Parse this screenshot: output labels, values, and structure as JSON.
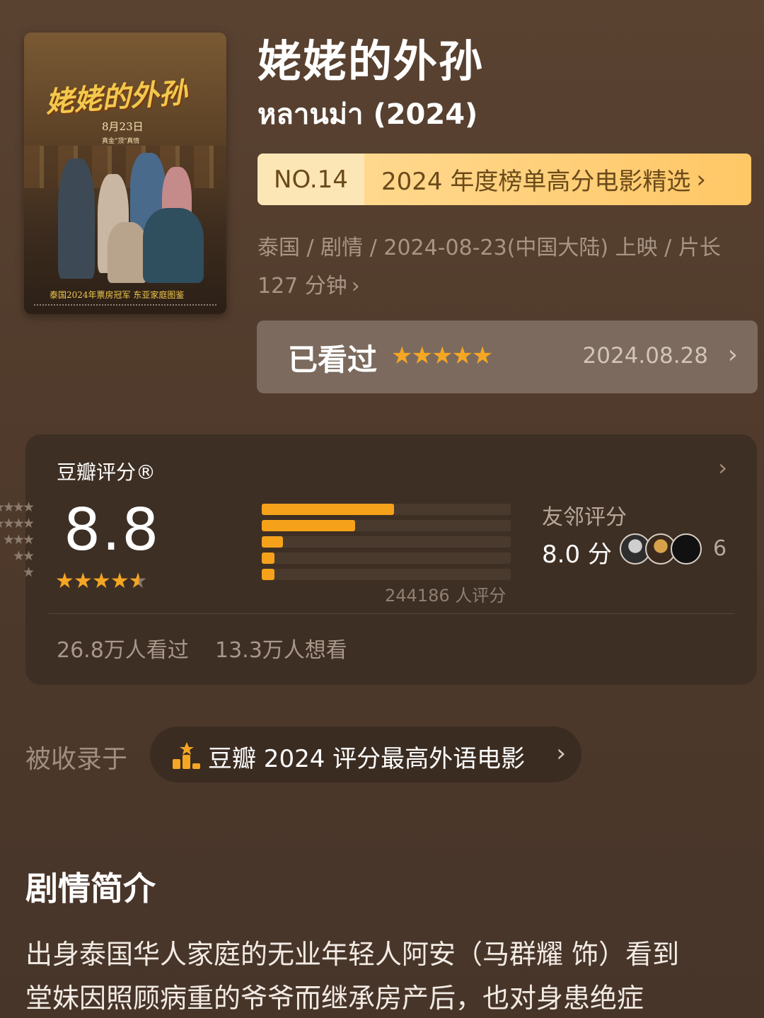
{
  "poster": {
    "title_art": "姥姥的外孙",
    "date": "8月23日",
    "subtitle": "真金\"顶\"真情",
    "tagline": "泰国2024年票房冠军 东亚家庭图鉴"
  },
  "movie": {
    "title": "姥姥的外孙",
    "original_title": "หลานม่า (2024)"
  },
  "ranking": {
    "number": "NO.14",
    "label": "2024 年度榜单高分电影精选",
    "chevron": "›"
  },
  "meta": {
    "line1": "泰国 / 剧情 / 2024-08-23(中国大陆) 上映 / 片长",
    "line2": "127 分钟",
    "chevron": "›"
  },
  "watched": {
    "label": "已看过",
    "stars": "★★★★★",
    "user_rating": 5,
    "date": "2024.08.28",
    "chevron": "›"
  },
  "douban_rating": {
    "label": "豆瓣评分®",
    "chevron": "›",
    "score": "8.8",
    "star_rating": 4.5,
    "distribution": [
      {
        "stars": "★★★★★",
        "fraction": 0.53
      },
      {
        "stars": "★★★★",
        "fraction": 0.375
      },
      {
        "stars": "★★★",
        "fraction": 0.085
      },
      {
        "stars": "★★",
        "fraction": 0.05
      },
      {
        "stars": "★",
        "fraction": 0.05
      }
    ],
    "rating_count": "244186 人评分",
    "friends_label": "友邻评分",
    "friends_score": "8.0 分",
    "friends_count": "6",
    "watched_count": "26.8万人看过",
    "want_count": "13.3万人想看"
  },
  "collected": {
    "label": "被收录于",
    "item": "豆瓣 2024 评分最高外语电影",
    "chevron": "›",
    "icon": "ranking-podium-icon"
  },
  "summary": {
    "heading": "剧情简介",
    "line1": "出身泰国华人家庭的无业年轻人阿安（马群耀 饰）看到",
    "line2": "堂妹因照顾病重的爷爷而继承房产后，也对身患绝症"
  },
  "colors": {
    "background": "#5a4231",
    "accent": "#f5a623",
    "rank_bar": "#ffd07a",
    "card": "#3e2f24"
  }
}
